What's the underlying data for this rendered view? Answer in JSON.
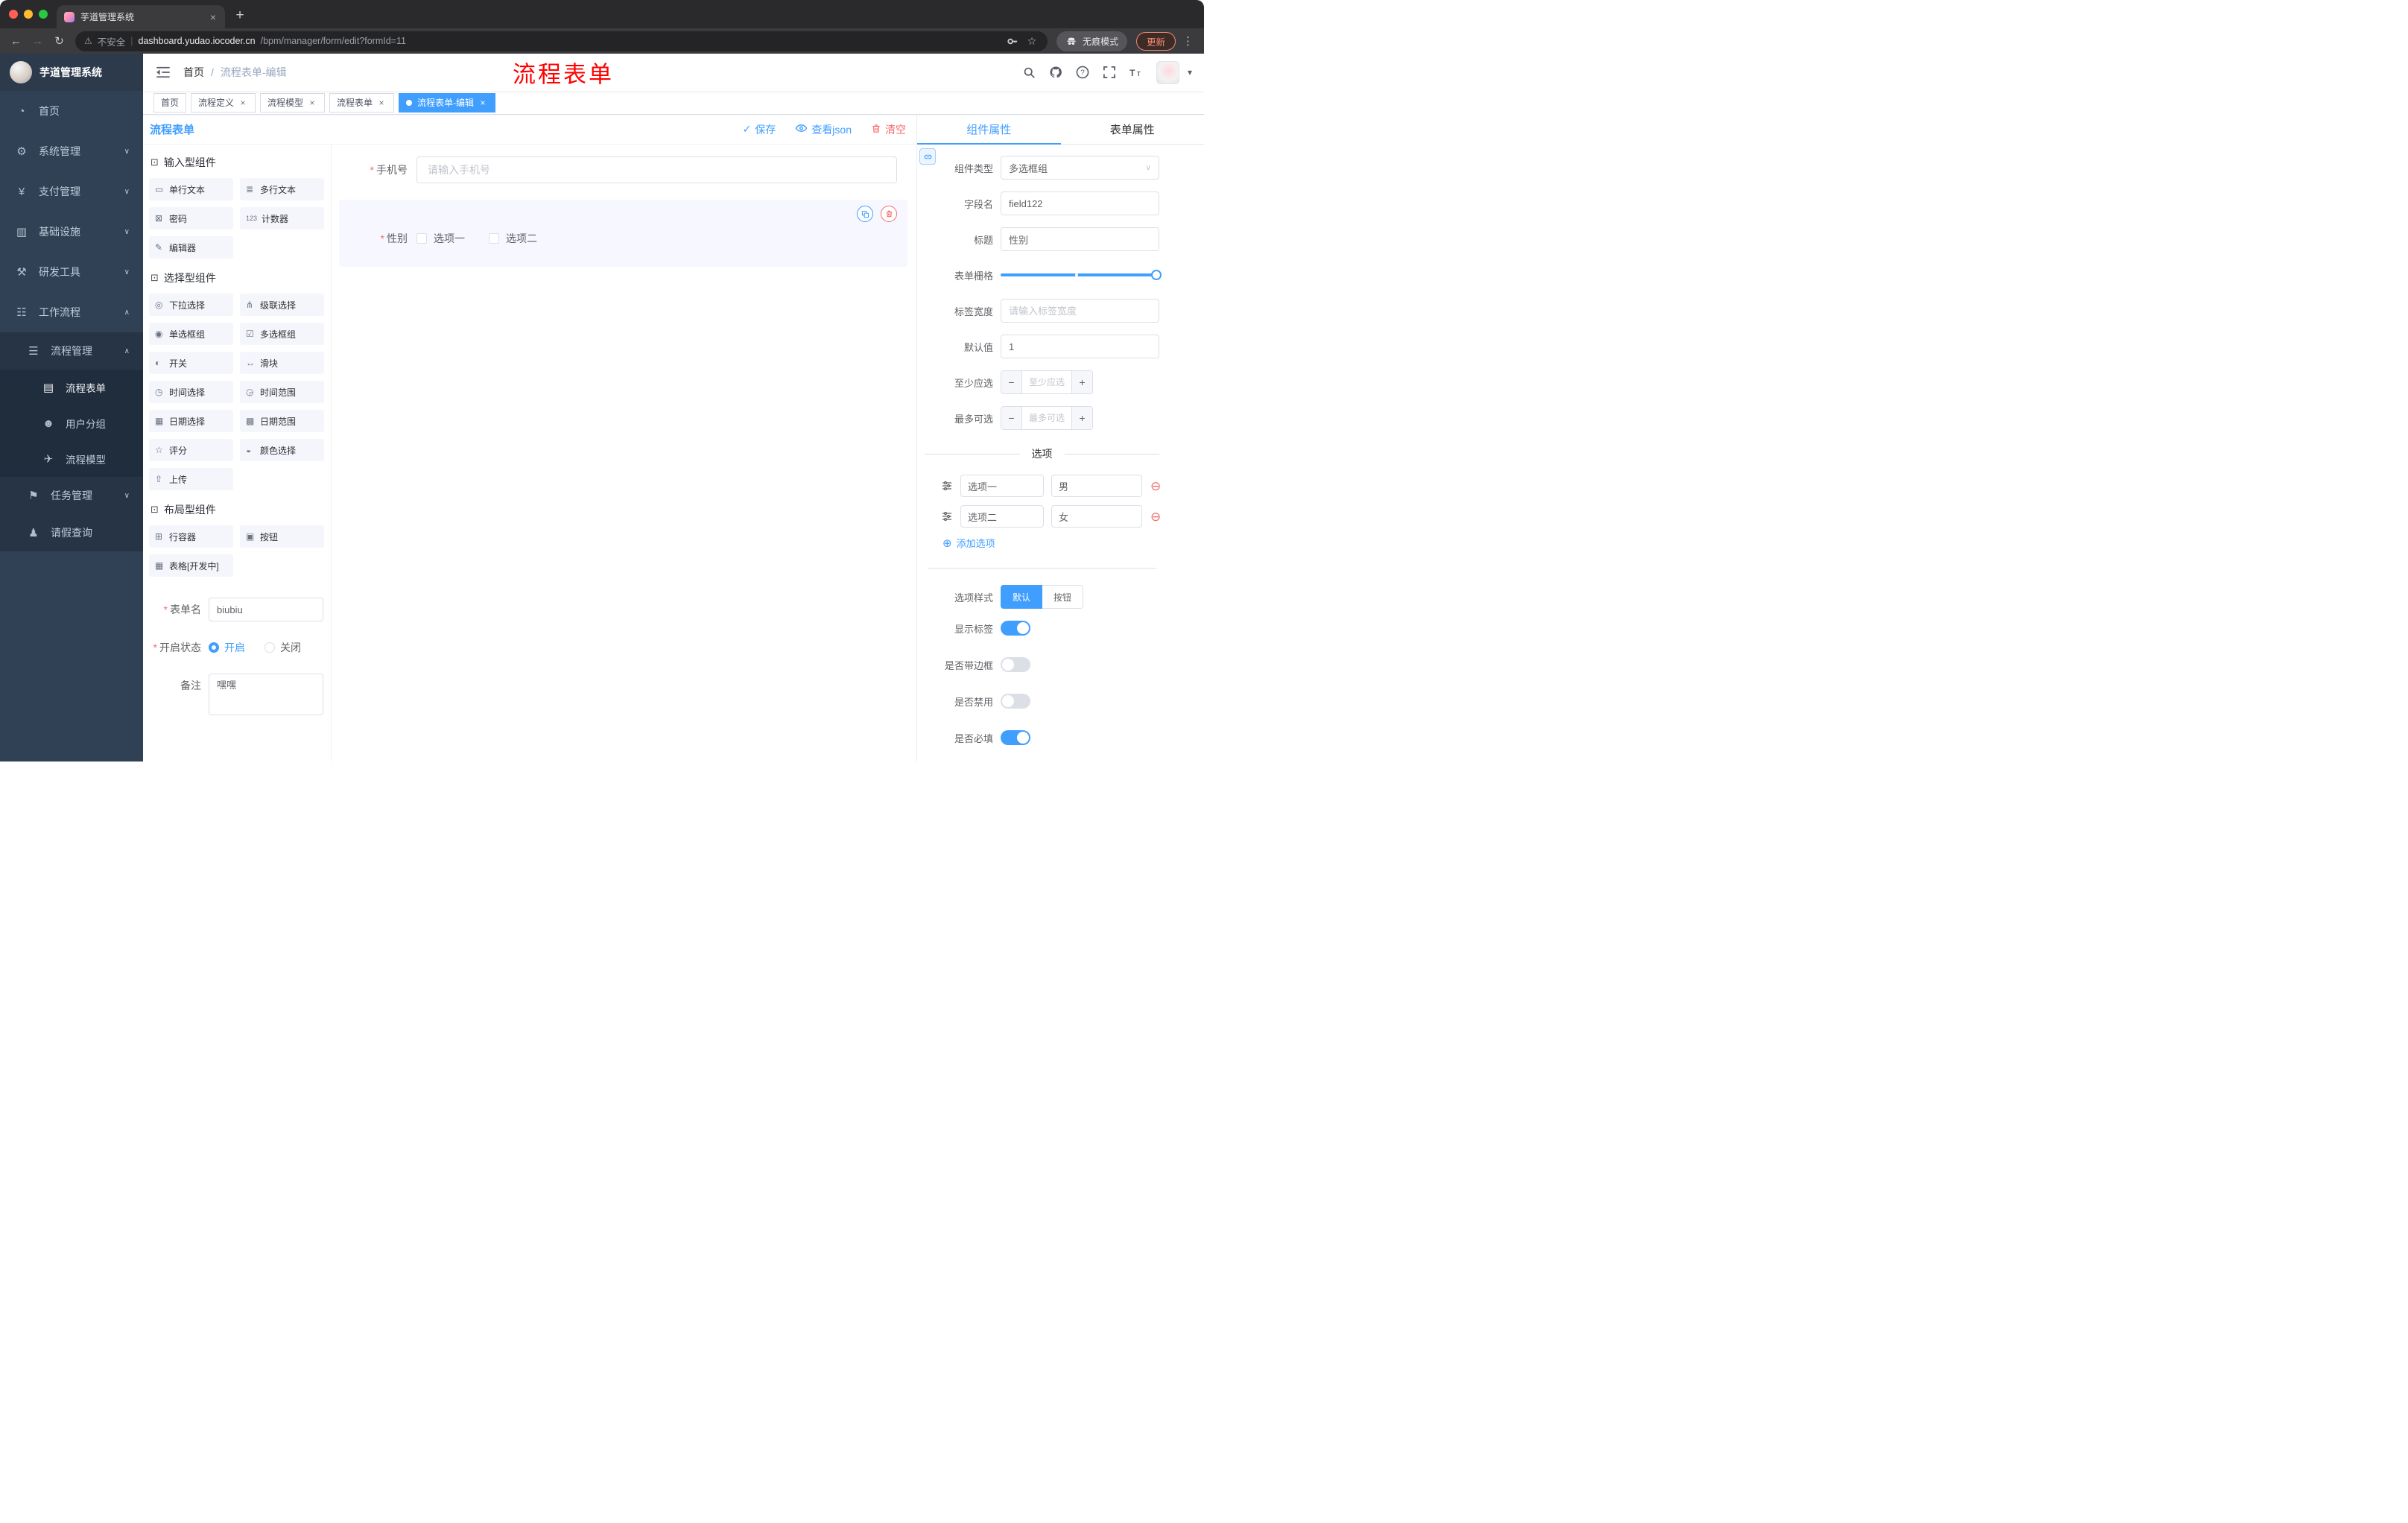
{
  "colors": {
    "primary": "#409eff",
    "danger": "#f56c6c",
    "sidebar_bg": "#304156",
    "submenu_bg": "#1f2d3d"
  },
  "icons": {
    "tab_favicon": "gradient-gem",
    "warning": "⚠",
    "star": "☆",
    "key": "svg-key",
    "incognito": "svg-spy",
    "kebab": "⋮",
    "back": "←",
    "forward": "→",
    "reload": "↻",
    "search": "svg-magnifier",
    "github": "svg-octocat",
    "help": "svg-question",
    "fullscreen": "svg-expand",
    "font_size": "T",
    "caret": "▾",
    "save_check": "✓",
    "view_eye": "svg-eye",
    "clear_trash": "svg-trash",
    "copy": "svg-copy",
    "delete": "svg-trash",
    "link": "svg-link",
    "drag": "svg-sliders",
    "remove_option": "⊖",
    "add_option": "⊕"
  },
  "browser": {
    "tab_title": "芋道管理系统",
    "security_label": "不安全",
    "url_domain": "dashboard.yudao.iocoder.cn",
    "url_path": "/bpm/manager/form/edit?formId=11",
    "incognito_label": "无痕模式",
    "update_label": "更新"
  },
  "sidebar": {
    "logo_title": "芋道管理系统",
    "menu": [
      {
        "icon": "◔",
        "label": "首页",
        "arrow": ""
      },
      {
        "icon": "⚙",
        "label": "系统管理",
        "arrow": "∨"
      },
      {
        "icon": "¥",
        "label": "支付管理",
        "arrow": "∨"
      },
      {
        "icon": "▥",
        "label": "基础设施",
        "arrow": "∨"
      },
      {
        "icon": "⚒",
        "label": "研发工具",
        "arrow": "∨"
      },
      {
        "icon": "☷",
        "label": "工作流程",
        "arrow": "∧"
      }
    ],
    "process_group": {
      "icon": "☰",
      "label": "流程管理",
      "arrow": "∧"
    },
    "process_children": [
      {
        "icon": "▤",
        "label": "流程表单"
      },
      {
        "icon": "☻",
        "label": "用户分组"
      },
      {
        "icon": "✈",
        "label": "流程模型"
      }
    ],
    "workflow_tail": [
      {
        "icon": "⚑",
        "label": "任务管理",
        "arrow": "∨"
      },
      {
        "icon": "♟",
        "label": "请假查询",
        "arrow": ""
      }
    ]
  },
  "header": {
    "breadcrumb_home": "首页",
    "breadcrumb_separator": "/",
    "breadcrumb_current": "流程表单-编辑",
    "annotation": "流程表单"
  },
  "tags": [
    {
      "label": "首页"
    },
    {
      "label": "流程定义"
    },
    {
      "label": "流程模型"
    },
    {
      "label": "流程表单"
    },
    {
      "label": "流程表单-编辑"
    }
  ],
  "designer": {
    "title": "流程表单",
    "actions": {
      "save": "保存",
      "view_json": "查看json",
      "clear": "清空"
    },
    "palette": [
      {
        "icon": "⊡",
        "title": "输入型组件",
        "items": [
          {
            "icon": "▭",
            "label": "单行文本"
          },
          {
            "icon": "≣",
            "label": "多行文本"
          },
          {
            "icon": "⊠",
            "label": "密码"
          },
          {
            "icon": "123",
            "label": "计数器"
          },
          {
            "icon": "✎",
            "label": "编辑器"
          }
        ]
      },
      {
        "icon": "⊡",
        "title": "选择型组件",
        "items": [
          {
            "icon": "◎",
            "label": "下拉选择"
          },
          {
            "icon": "⋔",
            "label": "级联选择"
          },
          {
            "icon": "◉",
            "label": "单选框组"
          },
          {
            "icon": "☑",
            "label": "多选框组"
          },
          {
            "icon": "◐",
            "label": "开关"
          },
          {
            "icon": "↔",
            "label": "滑块"
          },
          {
            "icon": "◷",
            "label": "时间选择"
          },
          {
            "icon": "◶",
            "label": "时间范围"
          },
          {
            "icon": "▦",
            "label": "日期选择"
          },
          {
            "icon": "▩",
            "label": "日期范围"
          },
          {
            "icon": "☆",
            "label": "评分"
          },
          {
            "icon": "◒",
            "label": "颜色选择"
          },
          {
            "icon": "⇧",
            "label": "上传"
          }
        ]
      },
      {
        "icon": "⊡",
        "title": "布局型组件",
        "items": [
          {
            "icon": "⊞",
            "label": "行容器"
          },
          {
            "icon": "▣",
            "label": "按钮"
          },
          {
            "icon": "▦",
            "label": "表格[开发中]"
          }
        ]
      }
    ],
    "meta": {
      "name_label": "表单名",
      "name_value": "biubiu",
      "status_label": "开启状态",
      "status_on": "开启",
      "status_off": "关闭",
      "status_selected": "开启",
      "remark_label": "备注",
      "remark_value": "嘿嘿"
    },
    "canvas": {
      "phone_label": "手机号",
      "phone_placeholder": "请输入手机号",
      "gender_label": "性别",
      "gender_options": [
        "选项一",
        "选项二"
      ]
    }
  },
  "props": {
    "tabs": {
      "component": "组件属性",
      "form": "表单属性",
      "active": "组件属性"
    },
    "type_label": "组件类型",
    "type_value": "多选框组",
    "field_label": "字段名",
    "field_value": "field122",
    "title_label": "标题",
    "title_value": "性别",
    "grid_label": "表单栅格",
    "label_width_label": "标签宽度",
    "label_width_placeholder": "请输入标签宽度",
    "default_label": "默认值",
    "default_value": "1",
    "min_label": "至少应选",
    "min_placeholder": "至少应选",
    "max_label": "最多可选",
    "max_placeholder": "最多可选",
    "options_title": "选项",
    "options": [
      {
        "label": "选项一",
        "value": "男"
      },
      {
        "label": "选项二",
        "value": "女"
      }
    ],
    "add_option_label": "添加选项",
    "style_label": "选项样式",
    "style_options": [
      "默认",
      "按钮"
    ],
    "style_selected": "默认",
    "switches": [
      {
        "label": "显示标签",
        "on": true
      },
      {
        "label": "是否带边框",
        "on": false
      },
      {
        "label": "是否禁用",
        "on": false
      },
      {
        "label": "是否必填",
        "on": true
      }
    ]
  }
}
